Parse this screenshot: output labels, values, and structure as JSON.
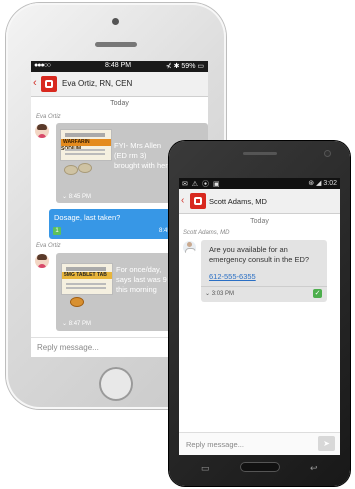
{
  "iphone": {
    "status": {
      "carrier": "●●●○○",
      "time": "8:48 PM",
      "battery": "⊀ ✱ 59% ▭"
    },
    "header": {
      "title": "Eva Ortiz, RN, CEN",
      "back": "‹"
    },
    "day": "Today",
    "messages": [
      {
        "sender": "Eva Ortiz",
        "text_lines": [
          "FYI- Mrs Allen",
          "(ED rm 3)",
          "brought with her"
        ],
        "time": "8:45 PM",
        "image_label": "WARFARIN SODIUM",
        "image_label_top": ""
      },
      {
        "text": "Dosage, last taken?",
        "time": "8:45 PM",
        "badge": "1"
      },
      {
        "sender": "Eva Ortiz",
        "text_lines": [
          "For once/day,",
          "says last was 9",
          "this morning"
        ],
        "time": "8:47 PM",
        "image_label": "5MG TABLET TAB"
      }
    ],
    "reply_placeholder": "Reply message..."
  },
  "android": {
    "status": {
      "left": "✉ ⚠ ⦿ ▣",
      "right": "⊛ ◢ 3:02"
    },
    "header": {
      "title": "Scott Adams, MD",
      "back": "‹"
    },
    "day": "Today",
    "message": {
      "sender": "Scott Adams, MD",
      "text_lines": [
        "Are you available for an",
        "emergency consult in the ED?"
      ],
      "phone": "612-555-6355",
      "time": "3:03 PM",
      "check": "✓"
    },
    "reply_placeholder": "Reply message...",
    "send_icon": "➤",
    "nav": {
      "recent": "▭",
      "back": "↩"
    }
  }
}
